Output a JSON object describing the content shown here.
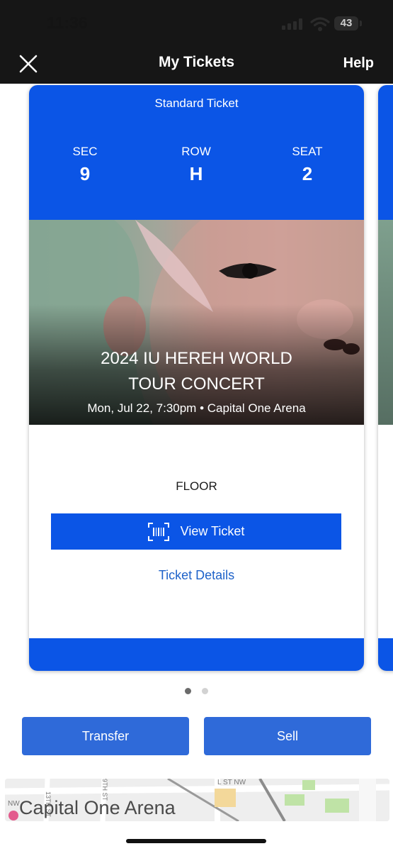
{
  "status_bar": {
    "time": "11:36",
    "battery": "43"
  },
  "nav": {
    "title": "My Tickets",
    "help": "Help"
  },
  "ticket": {
    "type": "Standard Ticket",
    "sec_label": "SEC",
    "sec": "9",
    "row_label": "ROW",
    "row": "H",
    "seat_label": "SEAT",
    "seat": "2",
    "event_line1": "2024 IU HEREH WORLD",
    "event_line2": "TOUR CONCERT",
    "event_meta": "Mon, Jul 22, 7:30pm • Capital One Arena",
    "section": "FLOOR",
    "view_button": "View Ticket",
    "details_link": "Ticket Details"
  },
  "pagination": {
    "total": 2,
    "active": 1
  },
  "actions": {
    "transfer": "Transfer",
    "sell": "Sell"
  },
  "map": {
    "label": "Capital One Arena",
    "street_labels": [
      "L ST NW",
      "NW",
      "13TH ST",
      "9TH ST"
    ]
  },
  "colors": {
    "brand_blue": "#0b55e6",
    "button_blue": "#2f6ad9",
    "link_blue": "#1e62c9",
    "nav_bg": "#161616"
  },
  "icons": [
    "close-icon",
    "barcode-icon",
    "wifi-icon",
    "signal-icon",
    "battery-icon"
  ]
}
